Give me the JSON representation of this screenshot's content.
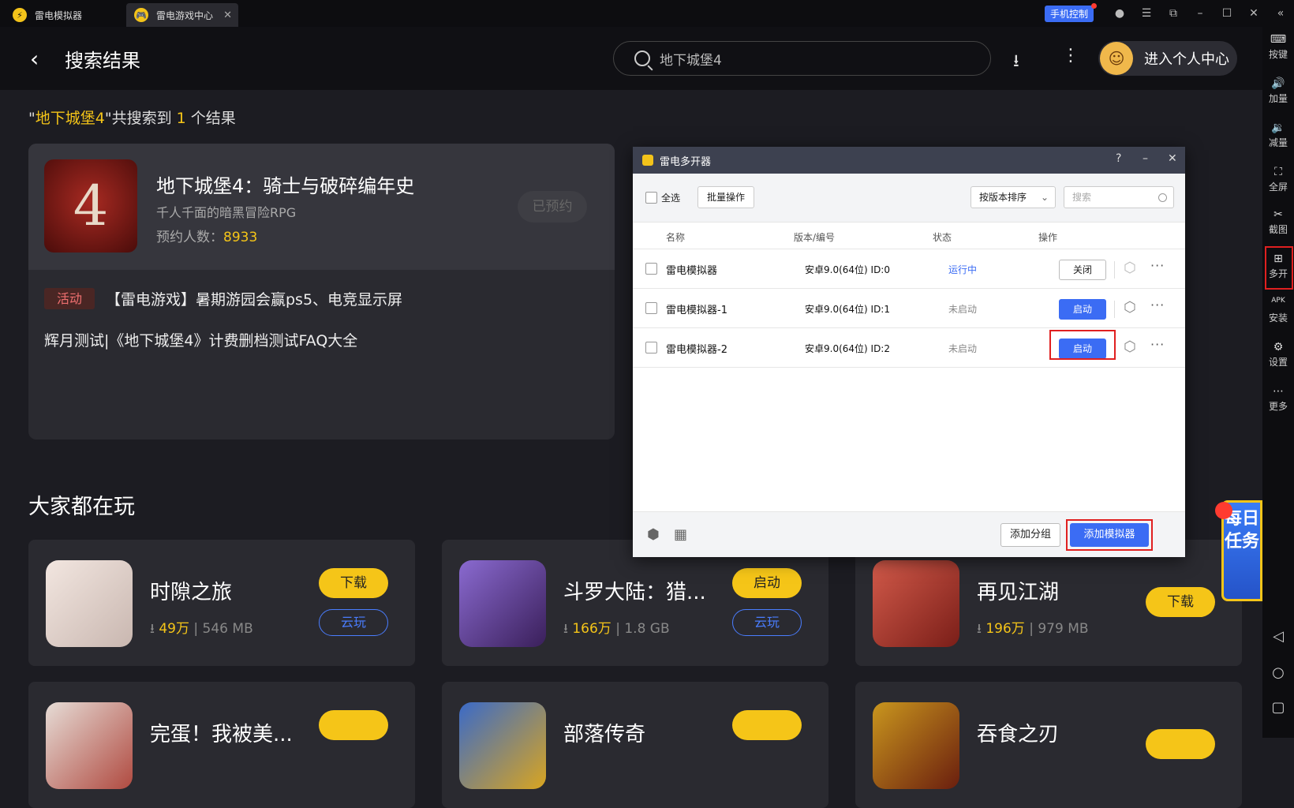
{
  "titlebar": {
    "tabs": [
      {
        "label": "雷电模拟器"
      },
      {
        "label": "雷电游戏中心"
      }
    ],
    "phone_control": "手机控制"
  },
  "topbar": {
    "title": "搜索结果",
    "search_value": "地下城堡4",
    "user_center": "进入个人中心"
  },
  "results": {
    "quote_open": "\"",
    "keyword": "地下城堡4",
    "quote_close": "\"共搜索到 ",
    "count": "1",
    "suffix": " 个结果"
  },
  "game": {
    "name": "地下城堡4：骑士与破碎编年史",
    "subtitle": "千人千面的暗黑冒险RPG",
    "reserve_label": "预约人数：",
    "reserve_count": "8933",
    "reserved_button": "已预约",
    "activity_tag": "活动",
    "activity_text": "【雷电游戏】暑期游园会赢ps5、电竞显示屏",
    "news": "辉月测试|《地下城堡4》计费删档测试FAQ大全"
  },
  "popular": {
    "title": "大家都在玩",
    "apps": [
      {
        "name": "时隙之旅",
        "downloads": "49万",
        "size": "546 MB",
        "primary": "下载",
        "secondary": "云玩",
        "color": "#e9dcd6"
      },
      {
        "name": "斗罗大陆：猎...",
        "downloads": "166万",
        "size": "1.8 GB",
        "primary": "启动",
        "secondary": "云玩",
        "color": "#6a4a9a"
      },
      {
        "name": "再见江湖",
        "downloads": "196万",
        "size": "979 MB",
        "primary": "下载",
        "secondary": "",
        "color": "#c2423a"
      },
      {
        "name": "完蛋！我被美...",
        "color": "#d9d0cb"
      },
      {
        "name": "部落传奇",
        "color": "#2c5aa8"
      },
      {
        "name": "吞食之刃",
        "color": "#7a3412"
      }
    ]
  },
  "dialog": {
    "title": "雷电多开器",
    "select_all": "全选",
    "batch": "批量操作",
    "sort": "按版本排序",
    "search_placeholder": "搜索",
    "columns": [
      "名称",
      "版本/编号",
      "状态",
      "操作"
    ],
    "rows": [
      {
        "name": "雷电模拟器",
        "version": "安卓9.0(64位)  ID:0",
        "status": "运行中",
        "action": "关闭"
      },
      {
        "name": "雷电模拟器-1",
        "version": "安卓9.0(64位)  ID:1",
        "status": "未启动",
        "action": "启动"
      },
      {
        "name": "雷电模拟器-2",
        "version": "安卓9.0(64位)  ID:2",
        "status": "未启动",
        "action": "启动"
      }
    ],
    "add_group": "添加分组",
    "add_emulator": "添加模拟器"
  },
  "sidebar": {
    "items": [
      {
        "label": "按键",
        "icon": "keyboard-icon"
      },
      {
        "label": "加量",
        "icon": "volume-up-icon"
      },
      {
        "label": "减量",
        "icon": "volume-down-icon"
      },
      {
        "label": "全屏",
        "icon": "fullscreen-icon"
      },
      {
        "label": "截图",
        "icon": "scissors-icon"
      },
      {
        "label": "多开",
        "icon": "multi-instance-icon"
      },
      {
        "label": "安装",
        "icon": "apk-icon"
      },
      {
        "label": "设置",
        "icon": "gear-icon"
      },
      {
        "label": "更多",
        "icon": "more-icon"
      }
    ]
  },
  "task_badge": "每日任务",
  "colors": {
    "accent": "#f5c518",
    "blue": "#3b6cf4",
    "highlight": "#e02020"
  }
}
